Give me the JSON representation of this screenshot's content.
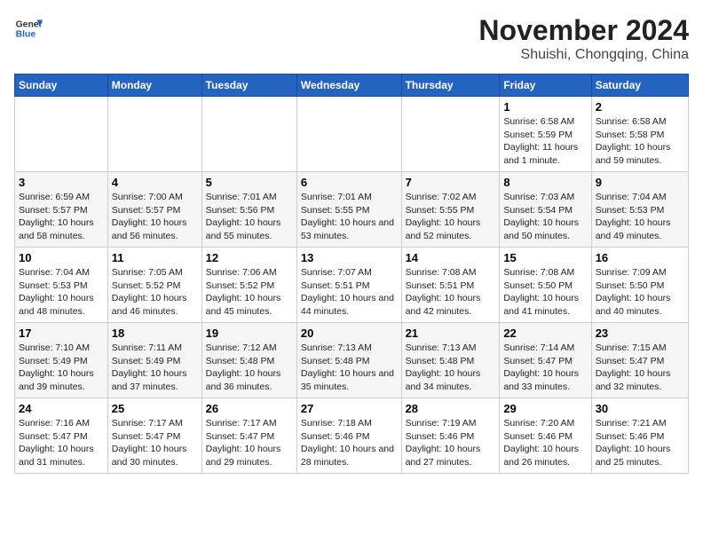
{
  "header": {
    "logo_line1": "General",
    "logo_line2": "Blue",
    "title": "November 2024",
    "subtitle": "Shuishi, Chongqing, China"
  },
  "weekdays": [
    "Sunday",
    "Monday",
    "Tuesday",
    "Wednesday",
    "Thursday",
    "Friday",
    "Saturday"
  ],
  "weeks": [
    [
      {
        "day": "",
        "info": ""
      },
      {
        "day": "",
        "info": ""
      },
      {
        "day": "",
        "info": ""
      },
      {
        "day": "",
        "info": ""
      },
      {
        "day": "",
        "info": ""
      },
      {
        "day": "1",
        "info": "Sunrise: 6:58 AM\nSunset: 5:59 PM\nDaylight: 11 hours and 1 minute."
      },
      {
        "day": "2",
        "info": "Sunrise: 6:58 AM\nSunset: 5:58 PM\nDaylight: 10 hours and 59 minutes."
      }
    ],
    [
      {
        "day": "3",
        "info": "Sunrise: 6:59 AM\nSunset: 5:57 PM\nDaylight: 10 hours and 58 minutes."
      },
      {
        "day": "4",
        "info": "Sunrise: 7:00 AM\nSunset: 5:57 PM\nDaylight: 10 hours and 56 minutes."
      },
      {
        "day": "5",
        "info": "Sunrise: 7:01 AM\nSunset: 5:56 PM\nDaylight: 10 hours and 55 minutes."
      },
      {
        "day": "6",
        "info": "Sunrise: 7:01 AM\nSunset: 5:55 PM\nDaylight: 10 hours and 53 minutes."
      },
      {
        "day": "7",
        "info": "Sunrise: 7:02 AM\nSunset: 5:55 PM\nDaylight: 10 hours and 52 minutes."
      },
      {
        "day": "8",
        "info": "Sunrise: 7:03 AM\nSunset: 5:54 PM\nDaylight: 10 hours and 50 minutes."
      },
      {
        "day": "9",
        "info": "Sunrise: 7:04 AM\nSunset: 5:53 PM\nDaylight: 10 hours and 49 minutes."
      }
    ],
    [
      {
        "day": "10",
        "info": "Sunrise: 7:04 AM\nSunset: 5:53 PM\nDaylight: 10 hours and 48 minutes."
      },
      {
        "day": "11",
        "info": "Sunrise: 7:05 AM\nSunset: 5:52 PM\nDaylight: 10 hours and 46 minutes."
      },
      {
        "day": "12",
        "info": "Sunrise: 7:06 AM\nSunset: 5:52 PM\nDaylight: 10 hours and 45 minutes."
      },
      {
        "day": "13",
        "info": "Sunrise: 7:07 AM\nSunset: 5:51 PM\nDaylight: 10 hours and 44 minutes."
      },
      {
        "day": "14",
        "info": "Sunrise: 7:08 AM\nSunset: 5:51 PM\nDaylight: 10 hours and 42 minutes."
      },
      {
        "day": "15",
        "info": "Sunrise: 7:08 AM\nSunset: 5:50 PM\nDaylight: 10 hours and 41 minutes."
      },
      {
        "day": "16",
        "info": "Sunrise: 7:09 AM\nSunset: 5:50 PM\nDaylight: 10 hours and 40 minutes."
      }
    ],
    [
      {
        "day": "17",
        "info": "Sunrise: 7:10 AM\nSunset: 5:49 PM\nDaylight: 10 hours and 39 minutes."
      },
      {
        "day": "18",
        "info": "Sunrise: 7:11 AM\nSunset: 5:49 PM\nDaylight: 10 hours and 37 minutes."
      },
      {
        "day": "19",
        "info": "Sunrise: 7:12 AM\nSunset: 5:48 PM\nDaylight: 10 hours and 36 minutes."
      },
      {
        "day": "20",
        "info": "Sunrise: 7:13 AM\nSunset: 5:48 PM\nDaylight: 10 hours and 35 minutes."
      },
      {
        "day": "21",
        "info": "Sunrise: 7:13 AM\nSunset: 5:48 PM\nDaylight: 10 hours and 34 minutes."
      },
      {
        "day": "22",
        "info": "Sunrise: 7:14 AM\nSunset: 5:47 PM\nDaylight: 10 hours and 33 minutes."
      },
      {
        "day": "23",
        "info": "Sunrise: 7:15 AM\nSunset: 5:47 PM\nDaylight: 10 hours and 32 minutes."
      }
    ],
    [
      {
        "day": "24",
        "info": "Sunrise: 7:16 AM\nSunset: 5:47 PM\nDaylight: 10 hours and 31 minutes."
      },
      {
        "day": "25",
        "info": "Sunrise: 7:17 AM\nSunset: 5:47 PM\nDaylight: 10 hours and 30 minutes."
      },
      {
        "day": "26",
        "info": "Sunrise: 7:17 AM\nSunset: 5:47 PM\nDaylight: 10 hours and 29 minutes."
      },
      {
        "day": "27",
        "info": "Sunrise: 7:18 AM\nSunset: 5:46 PM\nDaylight: 10 hours and 28 minutes."
      },
      {
        "day": "28",
        "info": "Sunrise: 7:19 AM\nSunset: 5:46 PM\nDaylight: 10 hours and 27 minutes."
      },
      {
        "day": "29",
        "info": "Sunrise: 7:20 AM\nSunset: 5:46 PM\nDaylight: 10 hours and 26 minutes."
      },
      {
        "day": "30",
        "info": "Sunrise: 7:21 AM\nSunset: 5:46 PM\nDaylight: 10 hours and 25 minutes."
      }
    ]
  ]
}
